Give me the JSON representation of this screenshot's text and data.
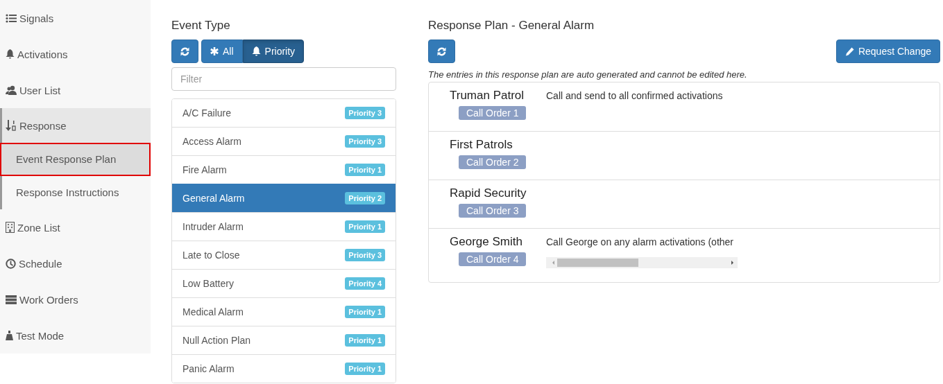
{
  "sidebar": {
    "items": [
      {
        "label": "Signals",
        "selected": false
      },
      {
        "label": "Activations",
        "selected": false
      },
      {
        "label": "User List",
        "selected": false
      },
      {
        "label": "Response",
        "selected": false,
        "expanded": true,
        "children": [
          {
            "label": "Event Response Plan",
            "selected": true
          },
          {
            "label": "Response Instructions",
            "selected": false
          }
        ]
      },
      {
        "label": "Zone List",
        "selected": false
      },
      {
        "label": "Schedule",
        "selected": false
      },
      {
        "label": "Work Orders",
        "selected": false
      },
      {
        "label": "Test Mode",
        "selected": false
      }
    ]
  },
  "event_type": {
    "title": "Event Type",
    "filters": [
      {
        "label": "All",
        "selected": false
      },
      {
        "label": "Priority",
        "selected": true
      }
    ],
    "filter_field": {
      "placeholder": "Filter"
    },
    "items": [
      {
        "name": "A/C Failure",
        "badge": "Priority 3",
        "selected": false
      },
      {
        "name": "Access Alarm",
        "badge": "Priority 3",
        "selected": false
      },
      {
        "name": "Fire Alarm",
        "badge": "Priority 1",
        "selected": false
      },
      {
        "name": "General Alarm",
        "badge": "Priority 2",
        "selected": true
      },
      {
        "name": "Intruder Alarm",
        "badge": "Priority 1",
        "selected": false
      },
      {
        "name": "Late to Close",
        "badge": "Priority 3",
        "selected": false
      },
      {
        "name": "Low Battery",
        "badge": "Priority 4",
        "selected": false
      },
      {
        "name": "Medical Alarm",
        "badge": "Priority 1",
        "selected": false
      },
      {
        "name": "Null Action Plan",
        "badge": "Priority 1",
        "selected": false
      },
      {
        "name": "Panic Alarm",
        "badge": "Priority 1",
        "selected": false
      }
    ]
  },
  "response_plan": {
    "title": "Response Plan - General Alarm",
    "request_button": "Request Change",
    "note": "The entries in this response plan are auto generated and cannot be edited here.",
    "rows": [
      {
        "name": "Truman Patrol",
        "badge": "Call Order 1",
        "instructions": "Call and send to all confirmed activations"
      },
      {
        "name": "First Patrols",
        "badge": "Call Order 2"
      },
      {
        "name": "Rapid Security",
        "badge": "Call Order 3"
      },
      {
        "name": "George Smith",
        "badge": "Call Order 4",
        "instructions": "Call George on any alarm activations (other",
        "scrollable": true
      }
    ]
  }
}
